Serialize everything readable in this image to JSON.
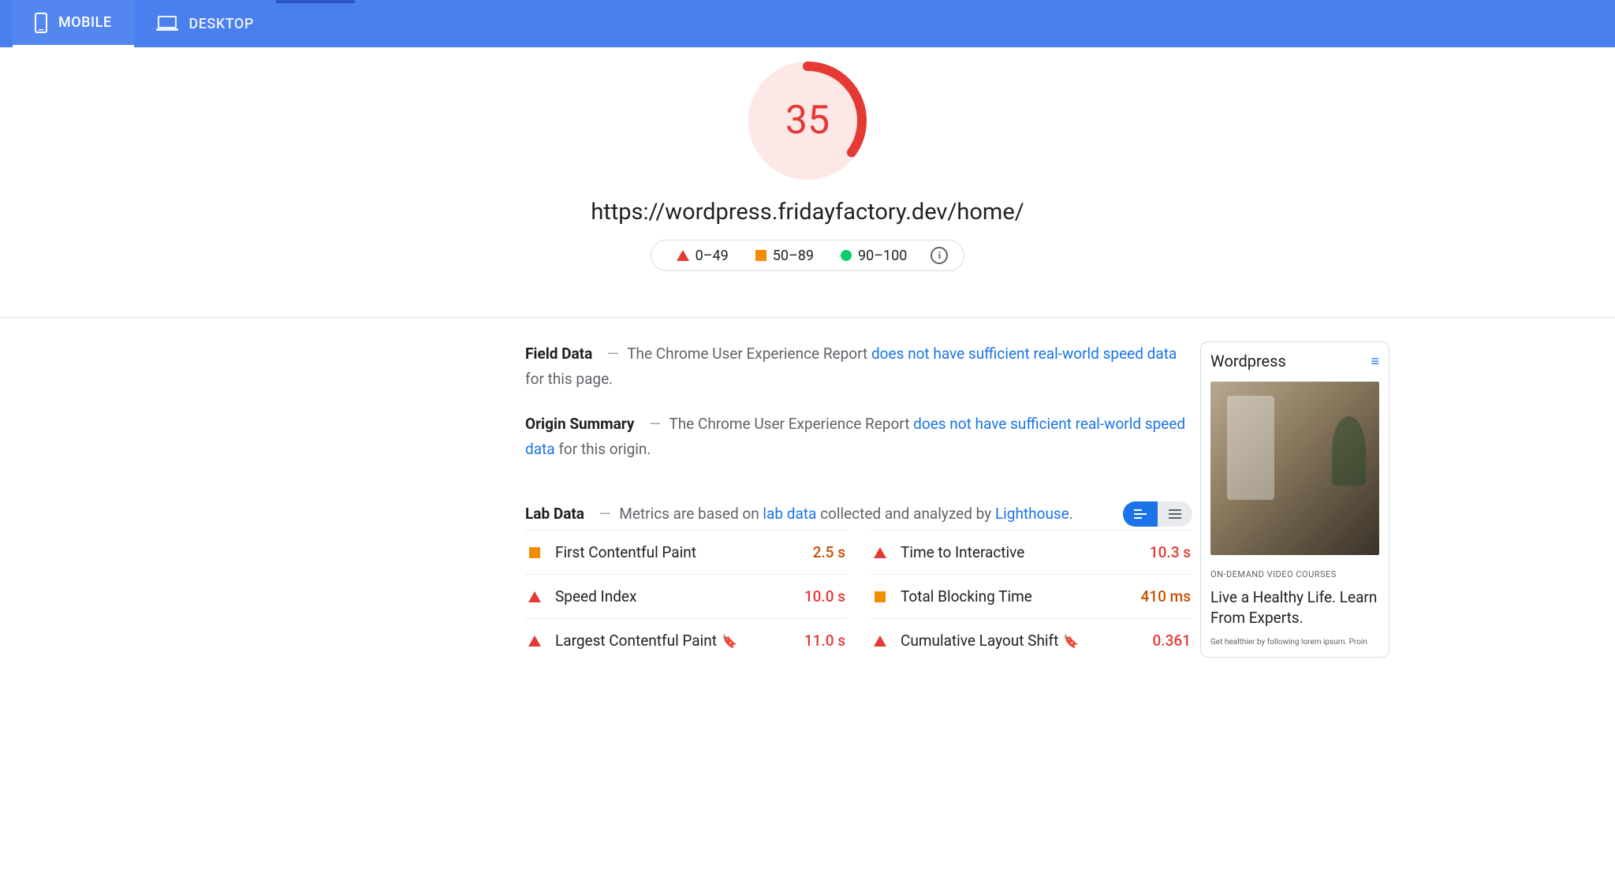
{
  "tabs": {
    "mobile": "MOBILE",
    "desktop": "DESKTOP"
  },
  "score": "35",
  "url": "https://wordpress.fridayfactory.dev/home/",
  "legend": {
    "poor": "0–49",
    "avg": "50–89",
    "good": "90–100"
  },
  "field": {
    "label": "Field Data",
    "pre": "The Chrome User Experience Report ",
    "link": "does not have sufficient real-world speed data",
    "post": " for this page."
  },
  "origin": {
    "label": "Origin Summary",
    "pre": "The Chrome User Experience Report ",
    "link": "does not have sufficient real-world speed data",
    "post": " for this origin."
  },
  "lab": {
    "label": "Lab Data",
    "pre": "Metrics are based on ",
    "link1": "lab data",
    "mid": " collected and analyzed by ",
    "link2": "Lighthouse",
    "post": "."
  },
  "metrics": {
    "fcp": {
      "name": "First Contentful Paint",
      "value": "2.5 s",
      "status": "avg"
    },
    "tti": {
      "name": "Time to Interactive",
      "value": "10.3 s",
      "status": "poor"
    },
    "si": {
      "name": "Speed Index",
      "value": "10.0 s",
      "status": "poor"
    },
    "tbt": {
      "name": "Total Blocking Time",
      "value": "410 ms",
      "status": "avg"
    },
    "lcp": {
      "name": "Largest Contentful Paint",
      "value": "11.0 s",
      "status": "poor"
    },
    "cls": {
      "name": "Cumulative Layout Shift",
      "value": "0.361",
      "status": "poor"
    }
  },
  "preview": {
    "title": "Wordpress",
    "kicker": "ON-DEMAND VIDEO COURSES",
    "headline": "Live a Healthy Life. Learn From Experts.",
    "sub": "Get healthier by following lorem ipsum. Proin"
  }
}
